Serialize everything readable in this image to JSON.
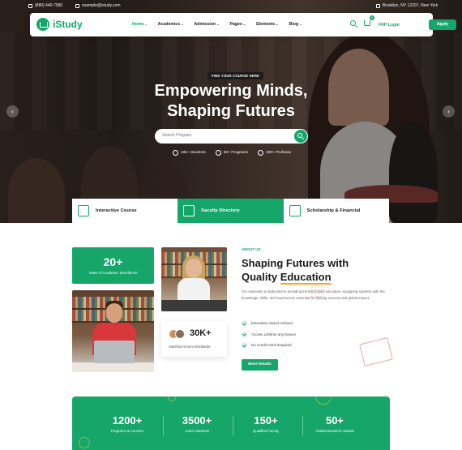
{
  "topbar": {
    "phone": "(880) 440-7580",
    "email": "example@istudy.com",
    "address": "Brooklyn, NY 12207, New York"
  },
  "brand": {
    "name": "iStudy",
    "color": "#16a66a"
  },
  "nav": {
    "items": [
      {
        "label": "Home",
        "active": true
      },
      {
        "label": "Academics"
      },
      {
        "label": "Admission"
      },
      {
        "label": "Pages"
      },
      {
        "label": "Elements"
      },
      {
        "label": "Blog"
      }
    ],
    "cart_count": "0",
    "login_label": "FRP Login",
    "apply_label": "Apply"
  },
  "hero": {
    "tagline": "FIND YOUR COURSE HERE",
    "title_line1": "Empowering Minds,",
    "title_line2": "Shaping Futures",
    "search_placeholder": "Search Program",
    "stats": [
      {
        "label": "10k+ Students"
      },
      {
        "label": "50+ Programs"
      },
      {
        "label": "200+ Professo"
      }
    ]
  },
  "features": [
    {
      "label": "Interactive Course",
      "icon": "books-icon"
    },
    {
      "label": "Faculty Directory",
      "icon": "faculty-icon",
      "active": true
    },
    {
      "label": "Scholarship & Financial",
      "icon": "diploma-icon"
    }
  ],
  "about": {
    "years_num": "20+",
    "years_label": "Years of Academic Excellence",
    "alumni_num": "30K+",
    "alumni_label": "Satisfied Alumni Worldwide",
    "eyebrow": "ABOUT US",
    "title_part1": "Shaping Futures with",
    "title_part2": "Quality ",
    "title_highlight": "Education",
    "description": "Our university is dedicated to providing transformative education, equipping students with the knowledge, skills, and experiences essential for lifelong success and global impact.",
    "checks": [
      "Education Award Achived",
      "Access Lifetime any Device",
      "No Credit Card Required"
    ],
    "button": "More Details"
  },
  "stats": [
    {
      "num": "1200+",
      "label": "Programs & Courses"
    },
    {
      "num": "3500+",
      "label": "Active Students"
    },
    {
      "num": "150+",
      "label": "Qualified Faculty"
    },
    {
      "num": "50+",
      "label": "Global Research Awards"
    }
  ]
}
